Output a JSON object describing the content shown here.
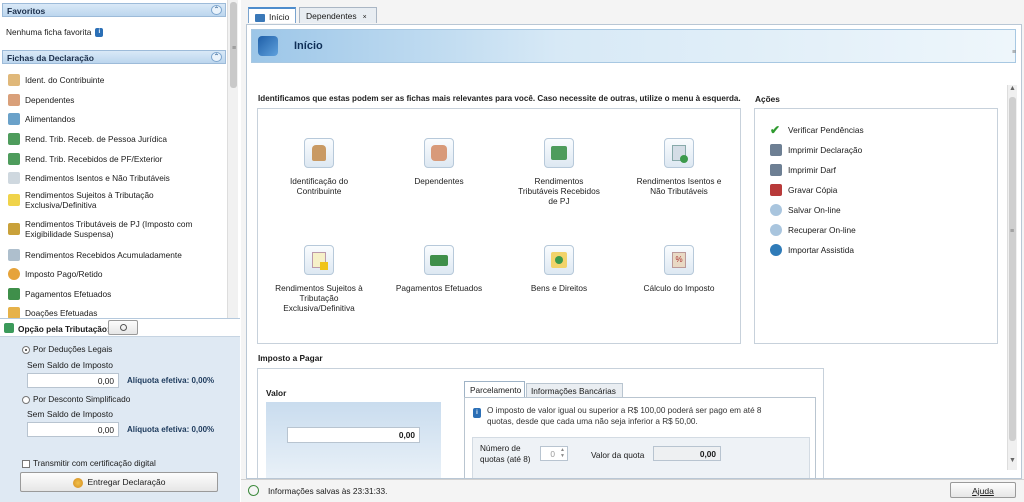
{
  "favoritos": {
    "title": "Favoritos",
    "empty_text": "Nenhuma ficha favorita"
  },
  "fichas": {
    "title": "Fichas da Declaração",
    "items": [
      {
        "label": "Ident. do Contribuinte"
      },
      {
        "label": "Dependentes"
      },
      {
        "label": "Alimentandos"
      },
      {
        "label": "Rend. Trib. Receb. de Pessoa Jurídica"
      },
      {
        "label": "Rend. Trib. Recebidos de PF/Exterior"
      },
      {
        "label": "Rendimentos Isentos e Não Tributáveis"
      },
      {
        "label_line1": "Rendimentos Sujeitos à Tributação",
        "label_line2": "Exclusiva/Definitiva"
      },
      {
        "label_line1": "Rendimentos Tributáveis de PJ (Imposto com",
        "label_line2": "Exigibilidade Suspensa)"
      },
      {
        "label": "Rendimentos Recebidos Acumuladamente"
      },
      {
        "label": "Imposto Pago/Retido"
      },
      {
        "label": "Pagamentos Efetuados"
      },
      {
        "label": "Doações Efetuadas"
      }
    ]
  },
  "opcao": {
    "title": "Opção pela Tributação:",
    "deducoes": {
      "label": "Por Deduções Legais",
      "sub": "Sem Saldo de Imposto",
      "value": "0,00",
      "aliquota": "Alíquota efetiva: 0,00%"
    },
    "simplificado": {
      "label": "Por Desconto Simplificado",
      "sub": "Sem Saldo de Imposto",
      "value": "0,00",
      "aliquota": "Alíquota efetiva: 0,00%"
    },
    "certificacao": "Transmitir com certificação digital",
    "entregar": "Entregar Declaração"
  },
  "tabs": [
    {
      "label": "Início"
    },
    {
      "label": "Dependentes"
    }
  ],
  "page_title": "Início",
  "intro_text": "Identificamos que estas podem ser as fichas mais relevantes para você. Caso necessite de outras, utilize o menu à esquerda.",
  "cards": [
    {
      "l1": "Identificação do",
      "l2": "Contribuinte",
      "l3": ""
    },
    {
      "l1": "Dependentes",
      "l2": "",
      "l3": ""
    },
    {
      "l1": "Rendimentos",
      "l2": "Tributáveis Recebidos",
      "l3": "de PJ"
    },
    {
      "l1": "Rendimentos Isentos e",
      "l2": "Não Tributáveis",
      "l3": ""
    },
    {
      "l1": "Rendimentos Sujeitos à",
      "l2": "Tributação",
      "l3": "Exclusiva/Definitiva"
    },
    {
      "l1": "Pagamentos Efetuados",
      "l2": "",
      "l3": ""
    },
    {
      "l1": "Bens e Direitos",
      "l2": "",
      "l3": ""
    },
    {
      "l1": "Cálculo do Imposto",
      "l2": "",
      "l3": ""
    }
  ],
  "acoes": {
    "title": "Ações",
    "items": [
      {
        "label": "Verificar Pendências"
      },
      {
        "label": "Imprimir Declaração"
      },
      {
        "label": "Imprimir Darf"
      },
      {
        "label": "Gravar Cópia"
      },
      {
        "label": "Salvar On-line"
      },
      {
        "label": "Recuperar On-line"
      },
      {
        "label": "Importar Assistida"
      }
    ]
  },
  "imposto": {
    "title": "Imposto a Pagar",
    "valor_label": "Valor",
    "valor": "0,00",
    "tabs": [
      "Parcelamento",
      "Informações Bancárias"
    ],
    "info_l1": "O imposto de valor igual ou superior a R$ 100,00 poderá ser pago em até 8",
    "info_l2": "quotas, desde que cada uma não seja inferior a R$ 50,00.",
    "quotas_l1": "Número de",
    "quotas_l2": "quotas (até 8)",
    "quotas_value": "0",
    "valor_quota_label": "Valor da quota",
    "valor_quota": "0,00"
  },
  "status": {
    "text": "Informações salvas às 23:31:33.",
    "ajuda": "Ajuda"
  },
  "colors": {
    "accent": "#4d8ccc",
    "panel_bg": "#dfe9f3",
    "header_bg": "#bcd6ee"
  }
}
